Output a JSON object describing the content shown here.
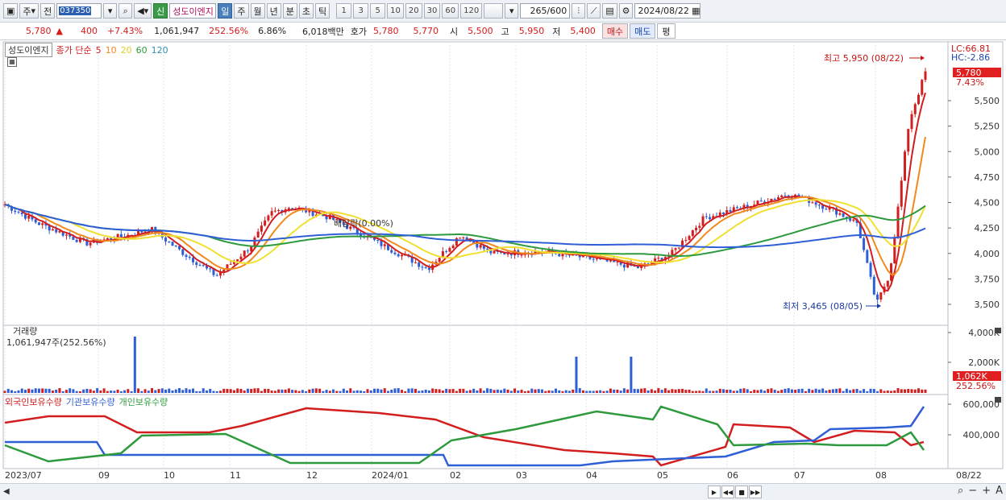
{
  "toolbar": {
    "period_select": "주",
    "prev_label": "전",
    "code": "037350",
    "badge_new": "신",
    "stock_name": "성도이엔지",
    "period_buttons": [
      "일",
      "주",
      "월",
      "년",
      "분",
      "초",
      "틱"
    ],
    "interval_buttons": [
      "1",
      "3",
      "5",
      "10",
      "20",
      "30",
      "60",
      "120"
    ],
    "count": "265",
    "count_total": "/600",
    "date": "2024/08/22"
  },
  "quote": {
    "price": "5,780",
    "change_arrow": "▲",
    "change": "400",
    "change_pct": "+7.43%",
    "volume": "1,061,947",
    "volume_ratio": "252.56%",
    "turnover": "6.86%",
    "amount": "6,018백만",
    "ask_label": "호가",
    "ask": "5,780",
    "bid": "5,770",
    "open_label": "시",
    "open": "5,500",
    "high_label": "고",
    "high": "5,950",
    "low_label": "저",
    "low": "5,400",
    "buy_button": "매수",
    "sell_button": "매도",
    "eval_button": "평"
  },
  "price_panel": {
    "legend_name": "성도이엔지",
    "legend_ma": "종가 단순",
    "ma_periods": [
      {
        "label": "5",
        "color": "#d21e1e"
      },
      {
        "label": "10",
        "color": "#f08a1c"
      },
      {
        "label": "20",
        "color": "#f0e030"
      },
      {
        "label": "60",
        "color": "#2e9a3e"
      },
      {
        "label": "120",
        "color": "#2f5fd6"
      }
    ],
    "lc_label": "LC:66.81",
    "hc_label": "HC:-2.86",
    "y_ticks": [
      "5,500",
      "5,250",
      "5,000",
      "4,750",
      "4,500",
      "4,250",
      "4,000",
      "3,750",
      "3,500"
    ],
    "current_price_tag": "5,780",
    "current_pct_tag": "7.43%",
    "high_annotation": "최고 5,950 (08/22)",
    "low_annotation": "최저 3,465 (08/05)",
    "dividend_annotation": "배당락(0.00%)"
  },
  "volume_panel": {
    "title": "거래량",
    "value": "1,061,947주(252.56%)",
    "y_ticks": [
      "4,000K",
      "2,000K"
    ],
    "current_tag": "1,062K",
    "current_pct": "252.56%"
  },
  "holding_panel": {
    "legend": [
      {
        "label": "외국인보유수량",
        "color": "#d21e1e"
      },
      {
        "label": "기관보유수량",
        "color": "#2f5fd6"
      },
      {
        "label": "개인보유수량",
        "color": "#2e9a3e"
      }
    ],
    "y_ticks": [
      "600,000",
      "400,000"
    ]
  },
  "x_axis": {
    "labels": [
      "2023/07",
      "09",
      "10",
      "11",
      "12",
      "2024/01",
      "02",
      "03",
      "04",
      "05",
      "06",
      "07",
      "08"
    ],
    "right_label": "08/22"
  },
  "colors": {
    "up": "#d21e1e",
    "down": "#2f5fd6",
    "ma5": "#d21e1e",
    "ma10": "#f08a1c",
    "ma20": "#f0e030",
    "ma60": "#2e9a3e",
    "ma120": "#2f5fd6"
  }
}
